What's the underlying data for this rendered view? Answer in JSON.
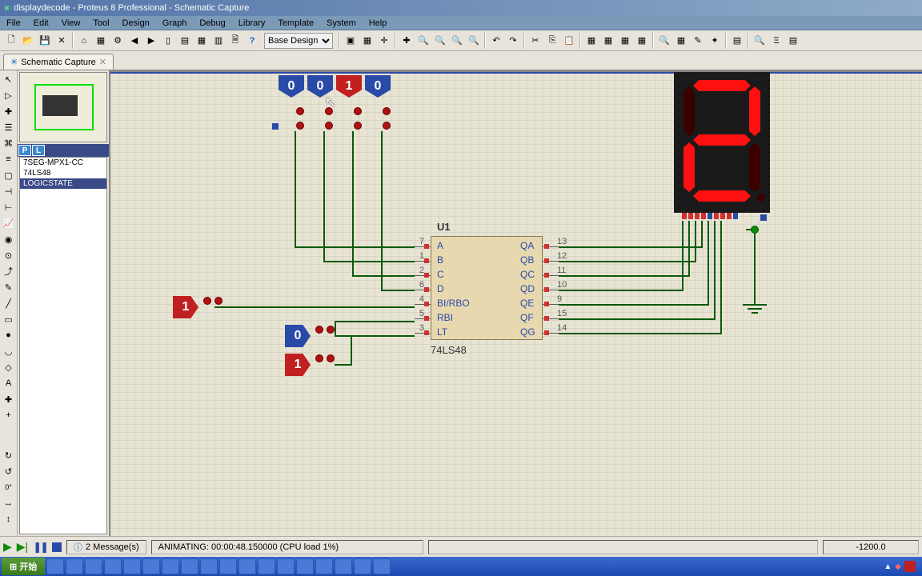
{
  "title": "displaydecode - Proteus 8 Professional - Schematic Capture",
  "menu": [
    "File",
    "Edit",
    "View",
    "Tool",
    "Design",
    "Graph",
    "Debug",
    "Library",
    "Template",
    "System",
    "Help"
  ],
  "design_combo": "Base Design",
  "tab": {
    "label": "Schematic Capture"
  },
  "devices": {
    "header_p": "P",
    "header_l": "L",
    "items": [
      "7SEG-MPX1-CC",
      "74LS48",
      "LOGICSTATE"
    ],
    "selected": 2
  },
  "schematic": {
    "chip_ref": "U1",
    "chip_type": "74LS48",
    "left_pins": [
      {
        "num": "7",
        "label": "A"
      },
      {
        "num": "1",
        "label": "B"
      },
      {
        "num": "2",
        "label": "C"
      },
      {
        "num": "6",
        "label": "D"
      },
      {
        "num": "4",
        "label": "BI/RBO"
      },
      {
        "num": "5",
        "label": "RBI"
      },
      {
        "num": "3",
        "label": "LT"
      }
    ],
    "right_pins": [
      {
        "num": "13",
        "label": "QA"
      },
      {
        "num": "12",
        "label": "QB"
      },
      {
        "num": "11",
        "label": "QC"
      },
      {
        "num": "10",
        "label": "QD"
      },
      {
        "num": "9",
        "label": "QE"
      },
      {
        "num": "15",
        "label": "QF"
      },
      {
        "num": "14",
        "label": "QG"
      }
    ],
    "top_states": [
      "0",
      "0",
      "1",
      "0"
    ],
    "top_colors": [
      "blue",
      "blue",
      "red",
      "blue"
    ],
    "side_states": [
      {
        "val": "1",
        "color": "red"
      },
      {
        "val": "0",
        "color": "blue"
      },
      {
        "val": "1",
        "color": "red"
      }
    ],
    "display_segments": {
      "a": true,
      "b": true,
      "c": false,
      "d": true,
      "e": true,
      "f": false,
      "g": true,
      "dp": false
    }
  },
  "status": {
    "messages": "2 Message(s)",
    "anim": "ANIMATING: 00:00:48.150000 (CPU load 1%)",
    "coord": "-1200.0"
  },
  "taskbar": {
    "start": "开始"
  },
  "colors": {
    "wire": "#0a5a0a",
    "chip": "#e8d8b0",
    "red": "#c02020",
    "blue": "#2a4aa8"
  }
}
